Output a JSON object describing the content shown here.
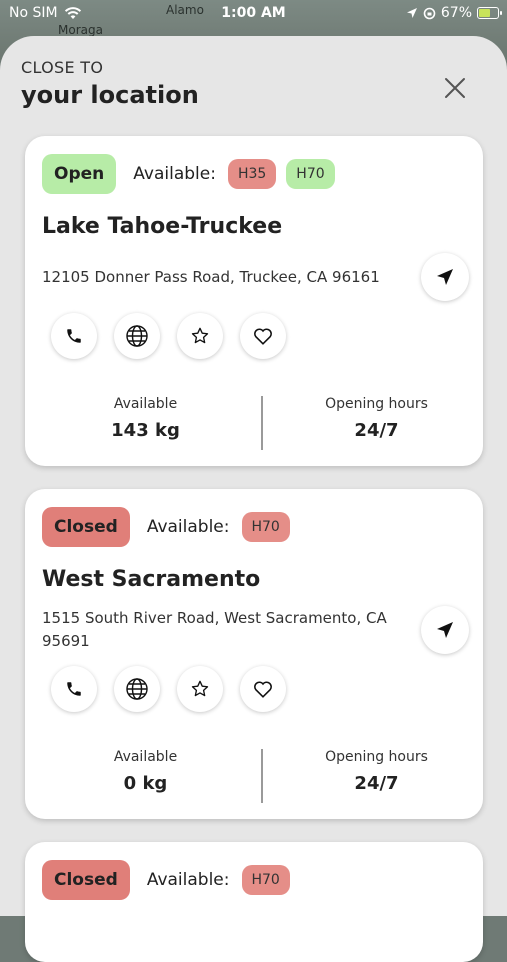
{
  "status_bar": {
    "carrier": "No SIM",
    "time": "1:00 AM",
    "battery": "67%",
    "battery_level": 0.67
  },
  "map": {
    "labels": [
      "Alamo",
      "Moraga"
    ]
  },
  "sheet": {
    "eyebrow": "CLOSE TO",
    "title": "your location"
  },
  "colors": {
    "open": "#b7eca7",
    "closed": "#e07f79",
    "chip_red": "#e58e88",
    "chip_green": "#b7eca7"
  },
  "available_label": "Available:",
  "stat_labels": {
    "available": "Available",
    "hours": "Opening hours"
  },
  "stations": [
    {
      "status": "Open",
      "fuels": [
        "H35",
        "H70"
      ],
      "name": "Lake Tahoe-Truckee",
      "address": "12105 Donner Pass Road, Truckee, CA 96161",
      "available": "143 kg",
      "hours": "24/7"
    },
    {
      "status": "Closed",
      "fuels": [
        "H70"
      ],
      "name": "West Sacramento",
      "address": "1515 South River Road, West Sacramento, CA 95691",
      "available": "0 kg",
      "hours": "24/7"
    },
    {
      "status": "Closed",
      "fuels": [
        "H70"
      ]
    }
  ]
}
